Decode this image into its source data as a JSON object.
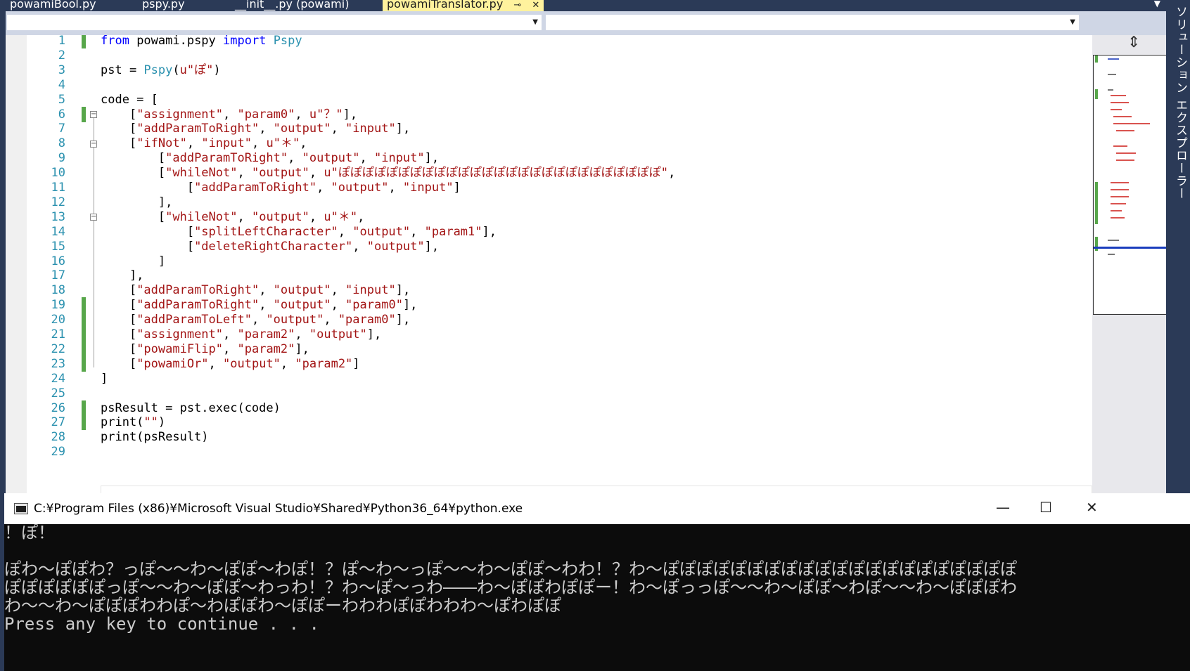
{
  "tabs": [
    {
      "label": "powamiBool.py"
    },
    {
      "label": "pspy.py"
    },
    {
      "label": "__init__.py (powami)"
    },
    {
      "label": "powamiTranslator.py"
    }
  ],
  "tab_overflow_icon": "chevron-down-icon",
  "side_panel_label": "ソリューション エクスプローラー",
  "editor": {
    "lines": [
      {
        "no": "1",
        "modified": true,
        "segments": [
          {
            "t": "from",
            "c": "kw"
          },
          {
            "t": " powami.pspy ",
            "c": "tx"
          },
          {
            "t": "import",
            "c": "kw"
          },
          {
            "t": " ",
            "c": "tx"
          },
          {
            "t": "Pspy",
            "c": "cls"
          }
        ]
      },
      {
        "no": "2",
        "modified": false,
        "segments": []
      },
      {
        "no": "3",
        "modified": false,
        "segments": [
          {
            "t": "pst = ",
            "c": "tx"
          },
          {
            "t": "Pspy",
            "c": "cls"
          },
          {
            "t": "(",
            "c": "tx"
          },
          {
            "t": "u\"ぽ\"",
            "c": "str"
          },
          {
            "t": ")",
            "c": "tx"
          }
        ]
      },
      {
        "no": "4",
        "modified": false,
        "segments": []
      },
      {
        "no": "5",
        "modified": false,
        "segments": [
          {
            "t": "code = [",
            "c": "tx"
          }
        ]
      },
      {
        "no": "6",
        "modified": true,
        "segments": [
          {
            "t": "    [",
            "c": "tx"
          },
          {
            "t": "\"assignment\"",
            "c": "str"
          },
          {
            "t": ", ",
            "c": "tx"
          },
          {
            "t": "\"param0\"",
            "c": "str"
          },
          {
            "t": ", ",
            "c": "tx"
          },
          {
            "t": "u\"？\"",
            "c": "str"
          },
          {
            "t": "],",
            "c": "tx"
          }
        ]
      },
      {
        "no": "7",
        "modified": false,
        "segments": [
          {
            "t": "    [",
            "c": "tx"
          },
          {
            "t": "\"addParamToRight\"",
            "c": "str"
          },
          {
            "t": ", ",
            "c": "tx"
          },
          {
            "t": "\"output\"",
            "c": "str"
          },
          {
            "t": ", ",
            "c": "tx"
          },
          {
            "t": "\"input\"",
            "c": "str"
          },
          {
            "t": "],",
            "c": "tx"
          }
        ]
      },
      {
        "no": "8",
        "modified": false,
        "segments": [
          {
            "t": "    [",
            "c": "tx"
          },
          {
            "t": "\"ifNot\"",
            "c": "str"
          },
          {
            "t": ", ",
            "c": "tx"
          },
          {
            "t": "\"input\"",
            "c": "str"
          },
          {
            "t": ", ",
            "c": "tx"
          },
          {
            "t": "u\"＊\"",
            "c": "str"
          },
          {
            "t": ",",
            "c": "tx"
          }
        ]
      },
      {
        "no": "9",
        "modified": false,
        "segments": [
          {
            "t": "        [",
            "c": "tx"
          },
          {
            "t": "\"addParamToRight\"",
            "c": "str"
          },
          {
            "t": ", ",
            "c": "tx"
          },
          {
            "t": "\"output\"",
            "c": "str"
          },
          {
            "t": ", ",
            "c": "tx"
          },
          {
            "t": "\"input\"",
            "c": "str"
          },
          {
            "t": "],",
            "c": "tx"
          }
        ]
      },
      {
        "no": "10",
        "modified": false,
        "segments": [
          {
            "t": "        [",
            "c": "tx"
          },
          {
            "t": "\"whileNot\"",
            "c": "str"
          },
          {
            "t": ", ",
            "c": "tx"
          },
          {
            "t": "\"output\"",
            "c": "str"
          },
          {
            "t": ", ",
            "c": "tx"
          },
          {
            "t": "u\"ぽぽぽぽぽぽぽぽぽぽぽぽぽぽぽぽぽぽぽぽぽぽぽぽぽぽぽ\"",
            "c": "str"
          },
          {
            "t": ",",
            "c": "tx"
          }
        ]
      },
      {
        "no": "11",
        "modified": false,
        "segments": [
          {
            "t": "            [",
            "c": "tx"
          },
          {
            "t": "\"addParamToRight\"",
            "c": "str"
          },
          {
            "t": ", ",
            "c": "tx"
          },
          {
            "t": "\"output\"",
            "c": "str"
          },
          {
            "t": ", ",
            "c": "tx"
          },
          {
            "t": "\"input\"",
            "c": "str"
          },
          {
            "t": "]",
            "c": "tx"
          }
        ]
      },
      {
        "no": "12",
        "modified": false,
        "segments": [
          {
            "t": "        ],",
            "c": "tx"
          }
        ]
      },
      {
        "no": "13",
        "modified": false,
        "segments": [
          {
            "t": "        [",
            "c": "tx"
          },
          {
            "t": "\"whileNot\"",
            "c": "str"
          },
          {
            "t": ", ",
            "c": "tx"
          },
          {
            "t": "\"output\"",
            "c": "str"
          },
          {
            "t": ", ",
            "c": "tx"
          },
          {
            "t": "u\"＊\"",
            "c": "str"
          },
          {
            "t": ",",
            "c": "tx"
          }
        ]
      },
      {
        "no": "14",
        "modified": false,
        "segments": [
          {
            "t": "            [",
            "c": "tx"
          },
          {
            "t": "\"splitLeftCharacter\"",
            "c": "str"
          },
          {
            "t": ", ",
            "c": "tx"
          },
          {
            "t": "\"output\"",
            "c": "str"
          },
          {
            "t": ", ",
            "c": "tx"
          },
          {
            "t": "\"param1\"",
            "c": "str"
          },
          {
            "t": "],",
            "c": "tx"
          }
        ]
      },
      {
        "no": "15",
        "modified": false,
        "segments": [
          {
            "t": "            [",
            "c": "tx"
          },
          {
            "t": "\"deleteRightCharacter\"",
            "c": "str"
          },
          {
            "t": ", ",
            "c": "tx"
          },
          {
            "t": "\"output\"",
            "c": "str"
          },
          {
            "t": "],",
            "c": "tx"
          }
        ]
      },
      {
        "no": "16",
        "modified": false,
        "segments": [
          {
            "t": "        ]",
            "c": "tx"
          }
        ]
      },
      {
        "no": "17",
        "modified": false,
        "segments": [
          {
            "t": "    ],",
            "c": "tx"
          }
        ]
      },
      {
        "no": "18",
        "modified": false,
        "segments": [
          {
            "t": "    [",
            "c": "tx"
          },
          {
            "t": "\"addParamToRight\"",
            "c": "str"
          },
          {
            "t": ", ",
            "c": "tx"
          },
          {
            "t": "\"output\"",
            "c": "str"
          },
          {
            "t": ", ",
            "c": "tx"
          },
          {
            "t": "\"input\"",
            "c": "str"
          },
          {
            "t": "],",
            "c": "tx"
          }
        ]
      },
      {
        "no": "19",
        "modified": true,
        "segments": [
          {
            "t": "    [",
            "c": "tx"
          },
          {
            "t": "\"addParamToRight\"",
            "c": "str"
          },
          {
            "t": ", ",
            "c": "tx"
          },
          {
            "t": "\"output\"",
            "c": "str"
          },
          {
            "t": ", ",
            "c": "tx"
          },
          {
            "t": "\"param0\"",
            "c": "str"
          },
          {
            "t": "],",
            "c": "tx"
          }
        ]
      },
      {
        "no": "20",
        "modified": true,
        "segments": [
          {
            "t": "    [",
            "c": "tx"
          },
          {
            "t": "\"addParamToLeft\"",
            "c": "str"
          },
          {
            "t": ", ",
            "c": "tx"
          },
          {
            "t": "\"output\"",
            "c": "str"
          },
          {
            "t": ", ",
            "c": "tx"
          },
          {
            "t": "\"param0\"",
            "c": "str"
          },
          {
            "t": "],",
            "c": "tx"
          }
        ]
      },
      {
        "no": "21",
        "modified": true,
        "segments": [
          {
            "t": "    [",
            "c": "tx"
          },
          {
            "t": "\"assignment\"",
            "c": "str"
          },
          {
            "t": ", ",
            "c": "tx"
          },
          {
            "t": "\"param2\"",
            "c": "str"
          },
          {
            "t": ", ",
            "c": "tx"
          },
          {
            "t": "\"output\"",
            "c": "str"
          },
          {
            "t": "],",
            "c": "tx"
          }
        ]
      },
      {
        "no": "22",
        "modified": true,
        "segments": [
          {
            "t": "    [",
            "c": "tx"
          },
          {
            "t": "\"powamiFlip\"",
            "c": "str"
          },
          {
            "t": ", ",
            "c": "tx"
          },
          {
            "t": "\"param2\"",
            "c": "str"
          },
          {
            "t": "],",
            "c": "tx"
          }
        ]
      },
      {
        "no": "23",
        "modified": true,
        "segments": [
          {
            "t": "    [",
            "c": "tx"
          },
          {
            "t": "\"powamiOr\"",
            "c": "str"
          },
          {
            "t": ", ",
            "c": "tx"
          },
          {
            "t": "\"output\"",
            "c": "str"
          },
          {
            "t": ", ",
            "c": "tx"
          },
          {
            "t": "\"param2\"",
            "c": "str"
          },
          {
            "t": "]",
            "c": "tx"
          }
        ]
      },
      {
        "no": "24",
        "modified": false,
        "segments": [
          {
            "t": "]",
            "c": "tx"
          }
        ]
      },
      {
        "no": "25",
        "modified": false,
        "segments": []
      },
      {
        "no": "26",
        "modified": true,
        "segments": [
          {
            "t": "psResult = pst.exec(code)",
            "c": "tx"
          }
        ]
      },
      {
        "no": "27",
        "modified": true,
        "segments": [
          {
            "t": "print(",
            "c": "tx"
          },
          {
            "t": "\"\"",
            "c": "str"
          },
          {
            "t": ")",
            "c": "tx"
          }
        ]
      },
      {
        "no": "28",
        "modified": false,
        "segments": [
          {
            "t": "print(psResult)",
            "c": "tx"
          }
        ]
      },
      {
        "no": "29",
        "modified": false,
        "segments": []
      }
    ]
  },
  "console": {
    "title": "C:¥Program Files (x86)¥Microsoft Visual Studio¥Shared¥Python36_64¥python.exe",
    "minimize_label": "—",
    "maximize_label": "☐",
    "close_label": "✕",
    "lines": [
      {
        "text": "！ぽ！",
        "wide": true
      },
      {
        "text": "",
        "wide": false
      },
      {
        "text": "ぽわ～ぽぽわ？っぽ～～わ～ぽぽ～わぽ！？ぽ～わ～っぽ～～わ～ぽぽ～わわ！？わ～ぽぽぽぽぽぽぽぽぽぽぽぽぽぽぽぽぽぽぽぽぽ",
        "wide": true
      },
      {
        "text": "ぽぽぽぽぽぽっぽ～～わ～ぽぽ～わっわ！？わ～ぽ～っわ――わ～ぽぽわぽぽー！わ～ぽっっぽ～～わ～ぽぽ～わぽ～～わ～ぽぽぽわ",
        "wide": true
      },
      {
        "text": "わ～～わ～ぽぽぽわわぽ～わぽぽわ～ぽぽーわわわぽぽわわわ～ぽわぽぽ",
        "wide": true
      },
      {
        "text": "Press any key to continue . . .",
        "wide": false
      }
    ]
  }
}
